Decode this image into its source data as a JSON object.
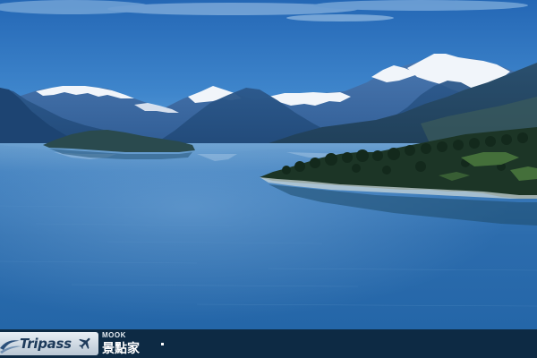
{
  "scene": {
    "colors": {
      "sky_top": "#2a6cb8",
      "sky_bottom": "#5b9fd6",
      "lake": "#2f6fb0",
      "snow": "#f2f6fa",
      "mountain_shadow": "#1f4f86",
      "forest": "#1e3a2a"
    }
  },
  "watermark": {
    "brand": "Tripass",
    "publisher_label": "MOOK",
    "publisher_name": "景點家",
    "icon": "airplane-icon"
  }
}
